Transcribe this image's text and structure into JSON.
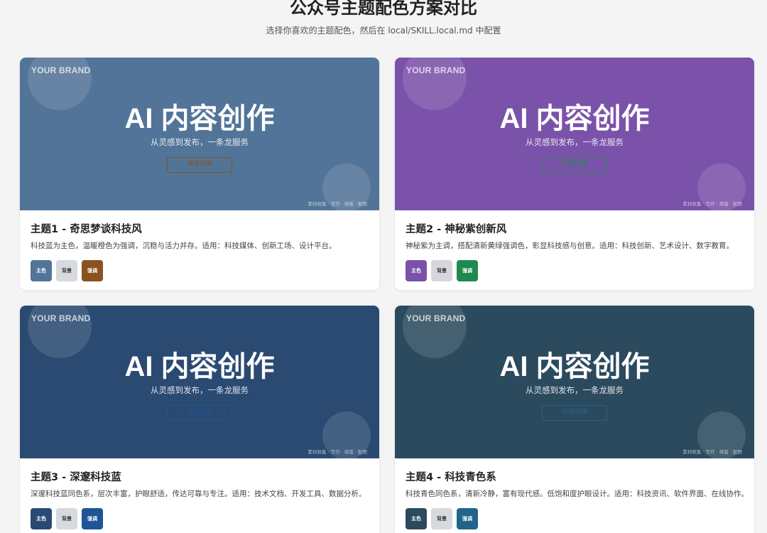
{
  "page": {
    "title": "公众号主题配色方案对比",
    "subtitle": "选择你喜欢的主题配色，然后在 local/SKILL.local.md 中配置"
  },
  "preview": {
    "brand": "YOUR BRAND",
    "hero": "AI 内容创作",
    "tagline": "从灵感到发布，一条龙服务",
    "cta": "快速出稿",
    "footer": "素材收集 · 写作 · 排版 · 配图"
  },
  "swatch_labels": {
    "primary": "主色",
    "background": "背景",
    "accent": "强调"
  },
  "themes": [
    {
      "title": "主题1 - 奇思梦谈科技风",
      "description": "科技蓝为主色，温暖橙色为强调，沉稳与活力并存。适用：科技媒体、创新工场、设计平台。",
      "colors": {
        "primary": "#527498",
        "background": "#d6d9dd",
        "accent": "#8a5220"
      }
    },
    {
      "title": "主题2 - 神秘紫创新风",
      "description": "神秘紫为主调，搭配清新黄绿强调色，彰显科技感与创意。适用：科技创新、艺术设计、数字教育。",
      "colors": {
        "primary": "#7b52a9",
        "background": "#d8d6dd",
        "accent": "#1f8a4f"
      }
    },
    {
      "title": "主题3 - 深邃科技蓝",
      "description": "深邃科技蓝同色系，层次丰富，护眼舒适，传达可靠与专注。适用：技术文档、开发工具、数据分析。",
      "colors": {
        "primary": "#2a4a72",
        "background": "#d6d9dd",
        "accent": "#1d5597"
      }
    },
    {
      "title": "主题4 - 科技青色系",
      "description": "科技青色同色系，清新冷静，富有现代感。低饱和度护眼设计。适用：科技资讯、软件界面、在线协作。",
      "colors": {
        "primary": "#2b4a5e",
        "background": "#d6d9dd",
        "accent": "#22658a"
      }
    }
  ]
}
